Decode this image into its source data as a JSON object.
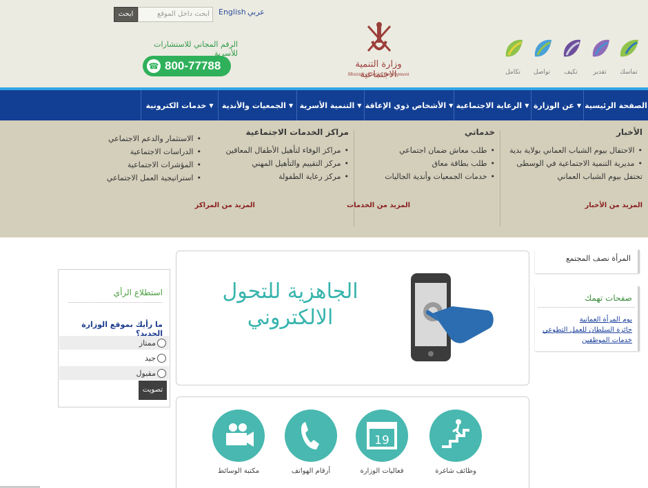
{
  "header": {
    "search_button": "ابحث",
    "search_placeholder": "ابحث داخل الموقع",
    "lang_english": "English",
    "lang_arabic": "عربي",
    "hotline_title": "الرقم المجاني للاستشارات للأسرية",
    "hotline_number": "800-77788",
    "ministry_name_ar": "وزارة التنمية الاجتماعية",
    "ministry_name_en": "Ministry of Social Development",
    "values": [
      "تماسك",
      "تقدير",
      "تكيف",
      "تواصل",
      "تكامل"
    ]
  },
  "nav": {
    "items": [
      {
        "label": "الصفحة الرئيسية",
        "caret": false
      },
      {
        "label": "عن الوزارة",
        "caret": true
      },
      {
        "label": "الرعاية الاجتماعية",
        "caret": true
      },
      {
        "label": "الأشخاص ذوي الإعاقة",
        "caret": true
      },
      {
        "label": "التنمية الأسرية",
        "caret": true
      },
      {
        "label": "الجمعيات والأندية",
        "caret": true
      },
      {
        "label": "خدمات الكترونية",
        "caret": true
      }
    ]
  },
  "mega": {
    "news": {
      "title": "الأخبار",
      "items": [
        "الاحتفال بيوم الشباب العماني بولاية بدية",
        "مديرية التنمية الاجتماعية في الوسطى تحتفل بيوم الشباب العماني"
      ],
      "more": "المزيد من الأخبار"
    },
    "services": {
      "title": "خدماتي",
      "items": [
        "طلب معاش ضمان اجتماعي",
        "طلب بطاقة معاق",
        "خدمات الجمعيات وأندية الجاليات"
      ],
      "more": "المزيد من الخدمات"
    },
    "centers": {
      "title": "مراكز الخدمات الاجتماعية",
      "items": [
        "مراكز الوفاء لتأهيل الأطفال المعاقين",
        "مركز التقييم والتأهيل المهني",
        "مركز رعاية الطفولة"
      ],
      "more": "المزيد من المراكز"
    },
    "other": {
      "items": [
        "الاستثمار والدعم الاجتماعي",
        "الدراسات الاجتماعية",
        "المؤشرات الاجتماعية",
        "استراتيجية العمل الاجتماعي"
      ]
    }
  },
  "sidebar": {
    "box1_text": "المرأة نصف المجتمع",
    "box2_title": "صفحات تهمك",
    "links": [
      "يوم المرأة العمانية",
      "جائزة السلطان للعمل التطوعي",
      "خدمات الموظفين"
    ]
  },
  "banner": {
    "text_line1": "الجاهزية للتحول",
    "text_line2": "الالكتروني"
  },
  "services": {
    "items": [
      {
        "label": "وظائف شاغرة",
        "icon": "stairs-icon"
      },
      {
        "label": "فعاليات الوزارة",
        "icon": "calendar-icon",
        "icon_text": "19"
      },
      {
        "label": "أرقام الهواتف",
        "icon": "phone-icon"
      },
      {
        "label": "مكتبة الوسائط",
        "icon": "video-camera-icon"
      }
    ]
  },
  "poll": {
    "title": "استطلاع الرأي",
    "question": "ما رأيك بموقع الوزارة الجديد؟",
    "options": [
      "ممتاز",
      "جيد",
      "مقبول"
    ],
    "vote_button": "تصويت"
  },
  "colors": {
    "nav_bg": "#123f93",
    "nav_accent": "#30a6e6",
    "header_bg": "#ecebe1",
    "mega_bg": "#d3cfbb",
    "teal": "#48b8b0",
    "hotline_green": "#2fb05a"
  }
}
